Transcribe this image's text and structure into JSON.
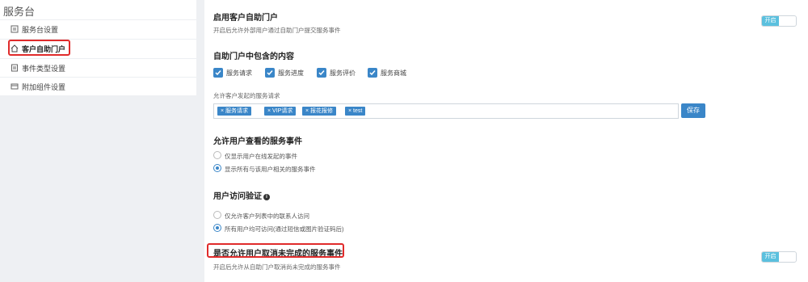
{
  "sidebar": {
    "title": "服务台",
    "items": [
      {
        "label": "服务台设置",
        "icon": "settings-list-icon"
      },
      {
        "label": "客户自助门户",
        "icon": "home-icon"
      },
      {
        "label": "事件类型设置",
        "icon": "document-icon"
      },
      {
        "label": "附加组件设置",
        "icon": "addon-icon"
      }
    ]
  },
  "portal_toggle": {
    "title": "启用客户自助门户",
    "desc": "开启后允许外部用户通过自助门户提交服务事件",
    "state_label": "开启"
  },
  "portal_content": {
    "title": "自助门户中包含的内容",
    "options": [
      "服务请求",
      "服务进度",
      "服务评价",
      "服务商城"
    ]
  },
  "allowed_requests": {
    "label": "允许客户发起的服务请求",
    "tags": [
      "服务请求",
      "VIP请求",
      "报花报修",
      "test"
    ],
    "save_label": "保存"
  },
  "view_events": {
    "title": "允许用户查看的服务事件",
    "options": [
      "仅显示用户在线发起的事件",
      "显示所有与该用户相关的服务事件"
    ]
  },
  "access_verify": {
    "title": "用户访问验证",
    "options": [
      "仅允许客户列表中的联系人访问",
      "所有用户均可访问(通过短信或图片验证码后)"
    ]
  },
  "cancel_events": {
    "title": "是否允许用户取消未完成的服务事件",
    "desc": "开启后允许从自助门户取消尚未完成的服务事件",
    "state_label": "开启"
  },
  "colors": {
    "accent": "#3a86c8",
    "toggle_on": "#5bc0de",
    "highlight": "#e02b2b"
  }
}
